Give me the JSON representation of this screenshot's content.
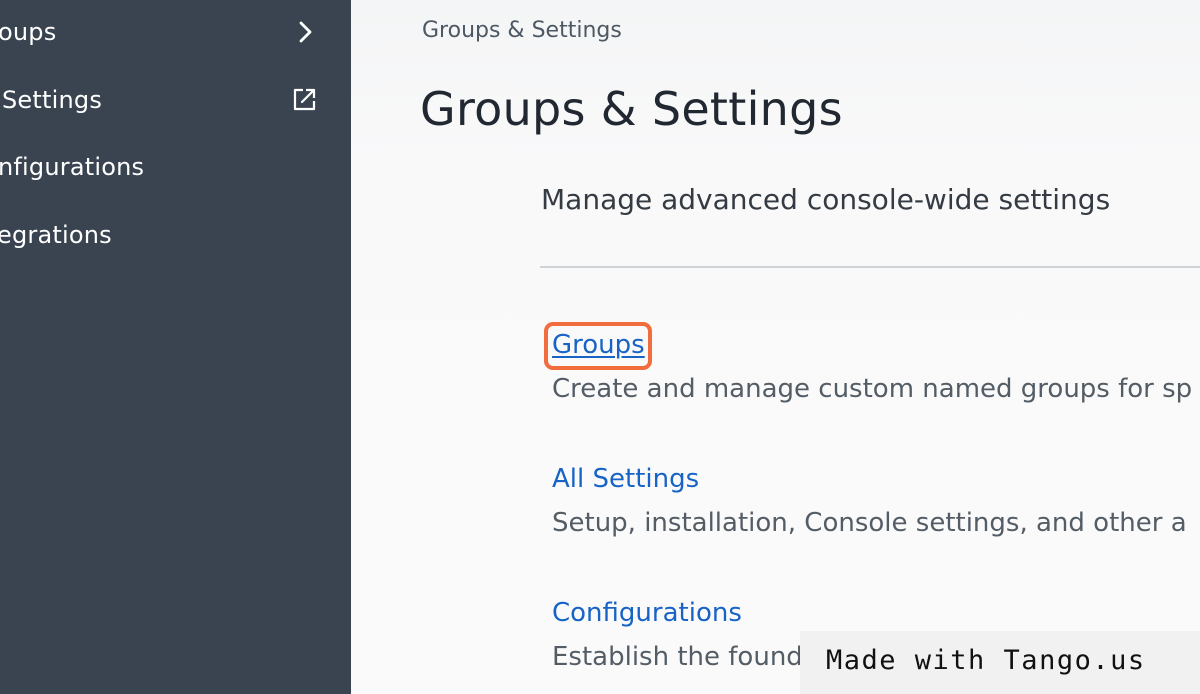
{
  "sidebar": {
    "items": [
      {
        "label": "oups",
        "icon": "chevron-right-icon"
      },
      {
        "label": "Settings",
        "icon": "external-link-icon"
      },
      {
        "label": "nfigurations",
        "icon": ""
      },
      {
        "label": "egrations",
        "icon": ""
      }
    ]
  },
  "main": {
    "breadcrumb": "Groups & Settings",
    "title": "Groups & Settings",
    "section_description": "Manage advanced console-wide settings",
    "entries": [
      {
        "link": "Groups",
        "description": "Create and manage custom named groups for sp"
      },
      {
        "link": "All Settings",
        "description": "Setup, installation, Console settings, and other a"
      },
      {
        "link": "Configurations",
        "description": "Establish the found"
      }
    ]
  },
  "watermark": {
    "text": "Made with Tango.us"
  },
  "colors": {
    "sidebar_bg": "#3a4451",
    "link": "#1863c6",
    "highlight": "#f26d3d"
  }
}
